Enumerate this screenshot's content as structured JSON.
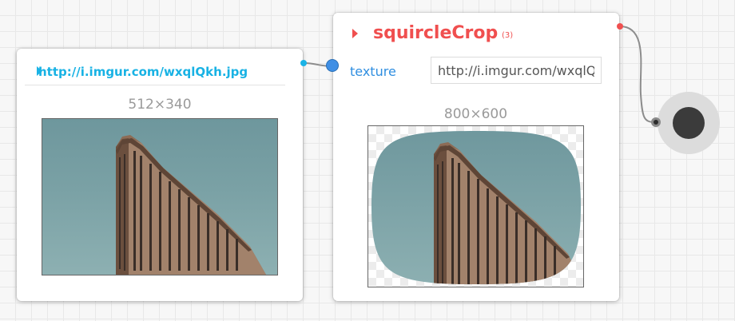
{
  "image_node": {
    "url": "http://i.imgur.com/wxqlQkh.jpg",
    "dimensions": "512×340"
  },
  "crop_node": {
    "title": "squircleCrop",
    "count": "(3)",
    "property_label": "texture",
    "property_value": "http://i.imgur.com/wxqlQkh.jpg",
    "dimensions": "800×600"
  },
  "colors": {
    "image_accent": "#18b2e4",
    "crop_accent": "#f04f4f",
    "property_label": "#2f8ee0",
    "output_port": "#f04f4f",
    "output_node_dot": "#3b3b3b"
  },
  "icons": {
    "image_caret": "triangle-right",
    "crop_caret": "triangle-right"
  }
}
